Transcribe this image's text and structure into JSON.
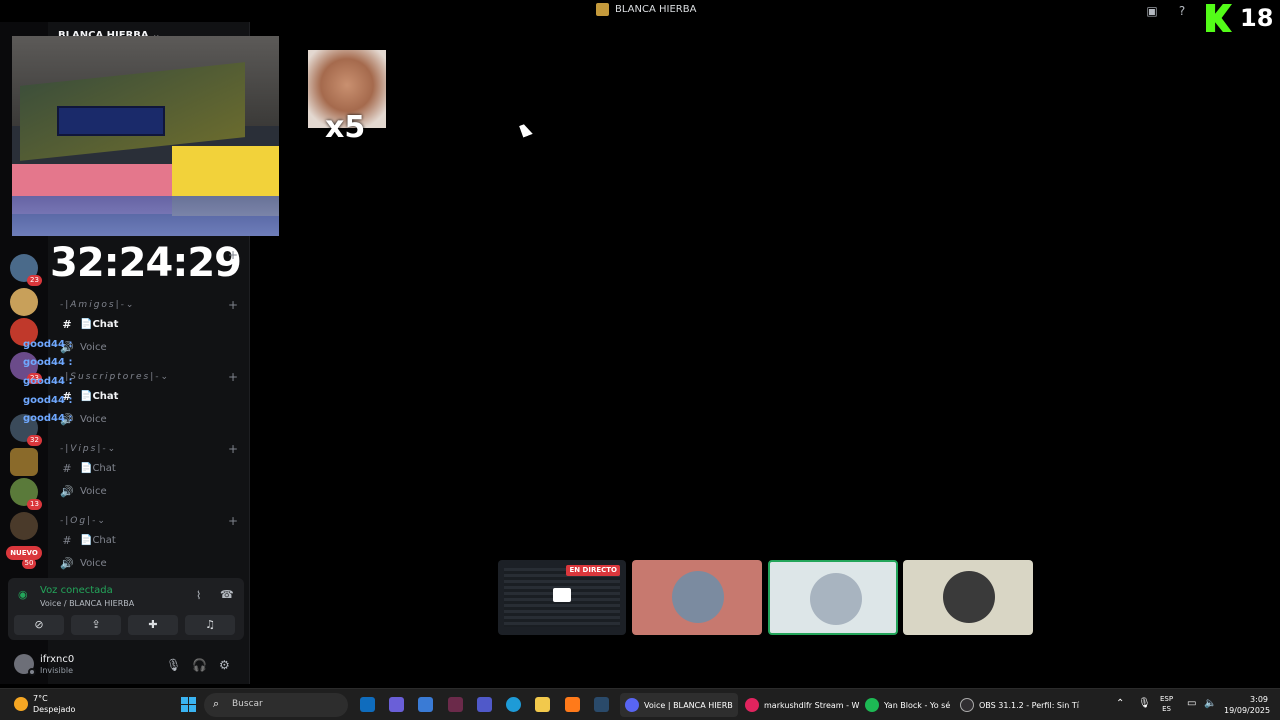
{
  "window": {
    "title": "BLANCA HIERBA"
  },
  "kick_badge": {
    "count": "18"
  },
  "server": {
    "name": "BLANCA HIERBA ⌄"
  },
  "stream_overlay": {
    "timer": "32:24:29",
    "emote_multiplier": "x5"
  },
  "server_rail": {
    "badges": [
      "23",
      "23",
      "32",
      "13"
    ],
    "nuevo_label": "NUEVO",
    "nuevo_count": "50"
  },
  "channels": {
    "categories": [
      {
        "label": "-|Amigos|-⌄",
        "chat": "📄Chat",
        "voice": "Voice"
      },
      {
        "label": "-|Suscriptores|-⌄",
        "chat": "📄Chat",
        "voice": "Voice"
      },
      {
        "label": "-|Vips|-⌄",
        "chat": "📄Chat",
        "voice": "Voice"
      },
      {
        "label": "-|Og|-⌄",
        "chat": "📄Chat",
        "voice": "Voice"
      }
    ]
  },
  "chat_overlay": {
    "lines": [
      "good44 :",
      "good44 :",
      "good44 :",
      "good44 :",
      "good44 :"
    ]
  },
  "voice_panel": {
    "status": "Voz conectada",
    "channel": "Voice / BLANCA HIERBA"
  },
  "user": {
    "name": "ifrxnc0",
    "status": "Invisible"
  },
  "stage": {
    "live_badge": "EN DIRECTO"
  },
  "taskbar": {
    "temperature": "7°C",
    "weather": "Despejado",
    "search_placeholder": "Buscar",
    "tasks": [
      "Voice | BLANCA HIERB",
      "markushdlfr Stream - W",
      "Yan Block - Yo sé",
      "OBS 31.1.2 - Perfil: Sin Tí"
    ],
    "language_top": "ESP",
    "language_bottom": "ES",
    "time": "3:09",
    "date": "19/09/2025"
  }
}
